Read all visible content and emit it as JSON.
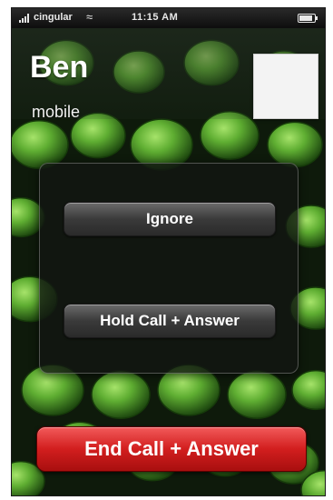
{
  "status_bar": {
    "carrier": "cingular",
    "time": "11:15 AM",
    "signal_icon": "signal-bars-icon",
    "wifi_icon": "wifi-icon",
    "battery_icon": "battery-icon"
  },
  "caller": {
    "name": "Ben",
    "label": "mobile",
    "photo_icon": "contact-photo-placeholder"
  },
  "actions": {
    "ignore_label": "Ignore",
    "hold_answer_label": "Hold Call + Answer",
    "end_answer_label": "End Call + Answer"
  },
  "colors": {
    "end_button": "#d21e1e",
    "panel_button": "#3a3a3a",
    "wallpaper": "#4e9a2e"
  }
}
